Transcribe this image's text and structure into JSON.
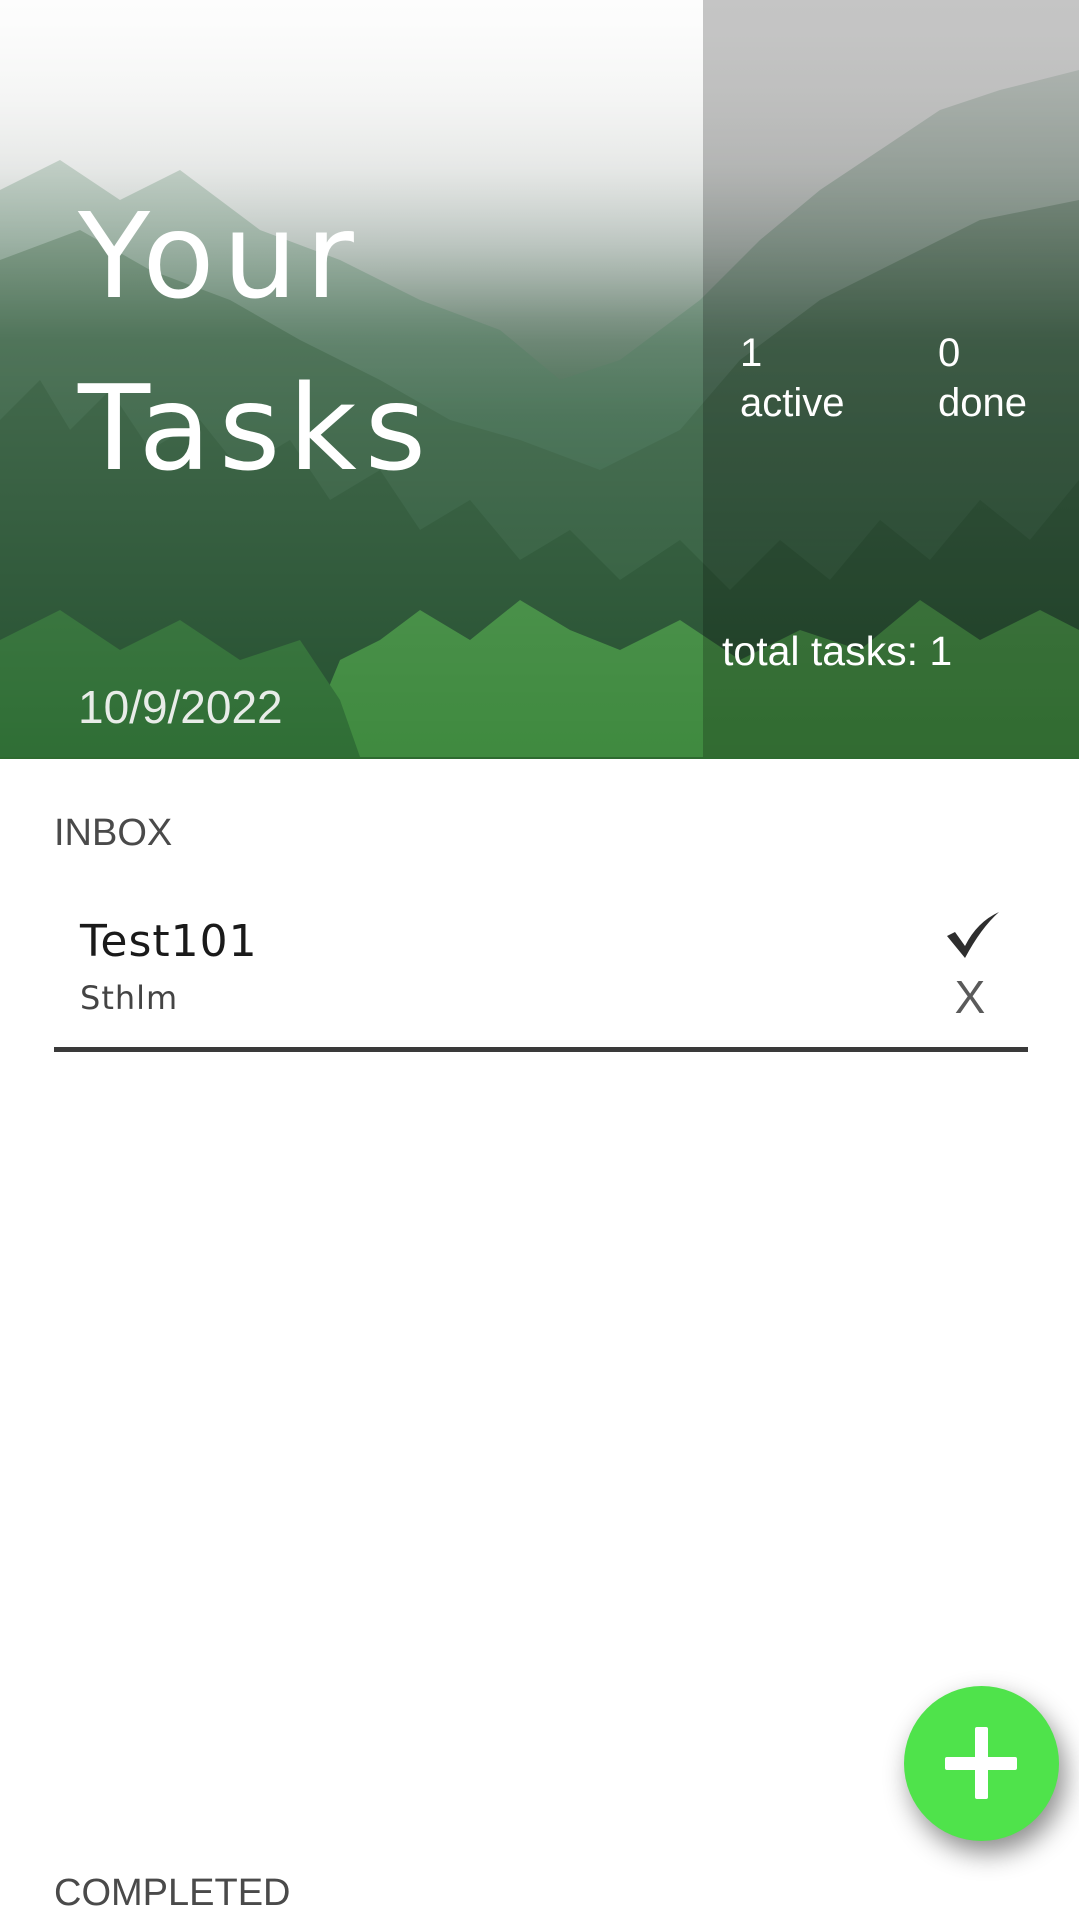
{
  "header": {
    "title_line1": "Your",
    "title_line2": "Tasks",
    "date": "10/9/2022",
    "active_count": "1",
    "active_label": "active",
    "done_count": "0",
    "done_label": "done",
    "total_tasks": "total tasks: 1"
  },
  "inbox": {
    "label": "INBOX",
    "tasks": [
      {
        "title": "Test101",
        "subtitle": "Sthlm",
        "check_icon": "checkmark-icon",
        "delete_label": "X"
      }
    ]
  },
  "completed": {
    "label": "COMPLETED"
  },
  "fab": {
    "icon": "plus-icon"
  },
  "colors": {
    "fab": "#4fe34b",
    "divider": "#3a3a3a",
    "forest": "#2f5a3c"
  }
}
